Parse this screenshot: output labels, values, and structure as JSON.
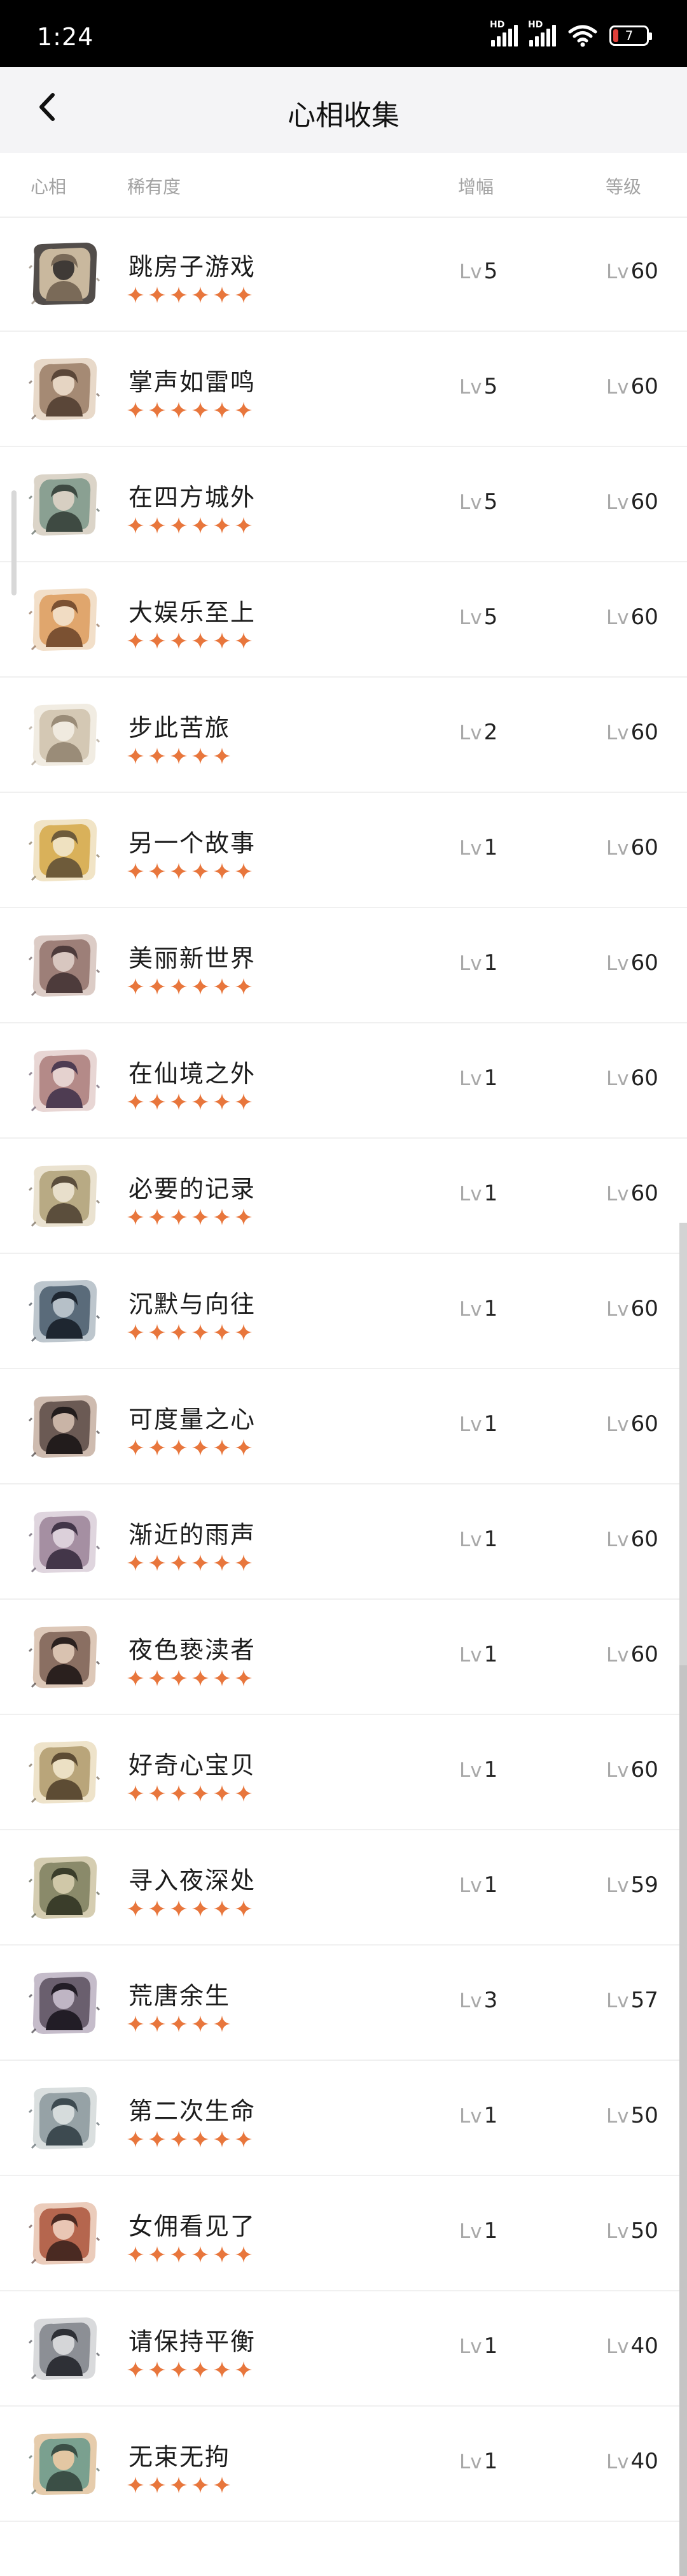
{
  "status_bar": {
    "time": "1:24",
    "signal_label_1": "HD",
    "signal_label_2": "HD",
    "battery_level": "7"
  },
  "header": {
    "title": "心相收集",
    "back_icon": "chevron-left-icon"
  },
  "columns": {
    "col_image": "心相",
    "col_rarity": "稀有度",
    "col_boost": "增幅",
    "col_level": "等级"
  },
  "accent_color": "#e8763c",
  "level_prefix": "Lv",
  "items": [
    {
      "name": "跳房子游戏",
      "stars": 6,
      "boost": "5",
      "level": "60"
    },
    {
      "name": "掌声如雷鸣",
      "stars": 6,
      "boost": "5",
      "level": "60"
    },
    {
      "name": "在四方城外",
      "stars": 6,
      "boost": "5",
      "level": "60"
    },
    {
      "name": "大娱乐至上",
      "stars": 6,
      "boost": "5",
      "level": "60"
    },
    {
      "name": "步此苦旅",
      "stars": 5,
      "boost": "2",
      "level": "60"
    },
    {
      "name": "另一个故事",
      "stars": 6,
      "boost": "1",
      "level": "60"
    },
    {
      "name": "美丽新世界",
      "stars": 6,
      "boost": "1",
      "level": "60"
    },
    {
      "name": "在仙境之外",
      "stars": 6,
      "boost": "1",
      "level": "60"
    },
    {
      "name": "必要的记录",
      "stars": 6,
      "boost": "1",
      "level": "60"
    },
    {
      "name": "沉默与向往",
      "stars": 6,
      "boost": "1",
      "level": "60"
    },
    {
      "name": "可度量之心",
      "stars": 6,
      "boost": "1",
      "level": "60"
    },
    {
      "name": "渐近的雨声",
      "stars": 6,
      "boost": "1",
      "level": "60"
    },
    {
      "name": "夜色亵渎者",
      "stars": 6,
      "boost": "1",
      "level": "60"
    },
    {
      "name": "好奇心宝贝",
      "stars": 6,
      "boost": "1",
      "level": "60"
    },
    {
      "name": "寻入夜深处",
      "stars": 6,
      "boost": "1",
      "level": "59"
    },
    {
      "name": "荒唐余生",
      "stars": 5,
      "boost": "3",
      "level": "57"
    },
    {
      "name": "第二次生命",
      "stars": 6,
      "boost": "1",
      "level": "50"
    },
    {
      "name": "女佣看见了",
      "stars": 6,
      "boost": "1",
      "level": "50"
    },
    {
      "name": "请保持平衡",
      "stars": 6,
      "boost": "1",
      "level": "40"
    },
    {
      "name": "无束无拘",
      "stars": 5,
      "boost": "1",
      "level": "40"
    }
  ]
}
